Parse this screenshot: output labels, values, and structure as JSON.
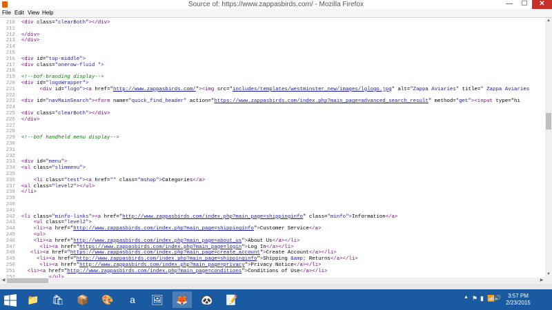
{
  "window": {
    "title": "Source of: https://www.zappasbirds.com/ - Mozilla Firefox",
    "minimize_glyph": "—",
    "maximize_glyph": "☐",
    "close_glyph": "✕"
  },
  "menubar": {
    "items": [
      "File",
      "Edit",
      "View",
      "Help"
    ]
  },
  "source_lines": [
    {
      "n": "210",
      "segs": [
        {
          "k": "t",
          "x": "<div "
        },
        {
          "k": "a",
          "x": "class="
        },
        {
          "k": "v",
          "x": "\"clearBoth\""
        },
        {
          "k": "t",
          "x": "></div>"
        }
      ]
    },
    {
      "n": "211",
      "segs": []
    },
    {
      "n": "212",
      "segs": [
        {
          "k": "t",
          "x": "</div>"
        }
      ]
    },
    {
      "n": "213",
      "segs": [
        {
          "k": "t",
          "x": "</div>"
        }
      ]
    },
    {
      "n": "214",
      "segs": []
    },
    {
      "n": "215",
      "segs": []
    },
    {
      "n": "216",
      "segs": [
        {
          "k": "t",
          "x": "<div "
        },
        {
          "k": "a",
          "x": "id="
        },
        {
          "k": "v",
          "x": "\"top-middle\""
        },
        {
          "k": "t",
          "x": ">"
        }
      ]
    },
    {
      "n": "217",
      "segs": [
        {
          "k": "t",
          "x": "<div "
        },
        {
          "k": "a",
          "x": "class="
        },
        {
          "k": "v",
          "x": "\"onerow-fluid \""
        },
        {
          "k": "t",
          "x": ">"
        }
      ]
    },
    {
      "n": "218",
      "segs": []
    },
    {
      "n": "219",
      "segs": [
        {
          "k": "c",
          "x": "<!--bof-branding display-->"
        }
      ]
    },
    {
      "n": "220",
      "segs": [
        {
          "k": "t",
          "x": "<div "
        },
        {
          "k": "a",
          "x": "id="
        },
        {
          "k": "v",
          "x": "\"logoWrapper\""
        },
        {
          "k": "t",
          "x": ">"
        }
      ]
    },
    {
      "n": "221",
      "segs": [
        {
          "k": "t",
          "x": "      <div "
        },
        {
          "k": "a",
          "x": "id="
        },
        {
          "k": "v",
          "x": "\"logo\""
        },
        {
          "k": "t",
          "x": "><a "
        },
        {
          "k": "a",
          "x": "href=\""
        },
        {
          "k": "l",
          "x": "http://www.zappasbirds.com/"
        },
        {
          "k": "a",
          "x": "\""
        },
        {
          "k": "t",
          "x": "><img "
        },
        {
          "k": "a",
          "x": "src=\""
        },
        {
          "k": "l",
          "x": "includes/templates/westminster_new/images/lglogo.jpg"
        },
        {
          "k": "a",
          "x": "\" alt="
        },
        {
          "k": "v",
          "x": "\"Zappa Aviaries\""
        },
        {
          "k": "a",
          "x": " title="
        },
        {
          "k": "v",
          "x": "\" Zappa Aviaries"
        }
      ]
    },
    {
      "n": "222",
      "segs": []
    },
    {
      "n": "223",
      "segs": [
        {
          "k": "t",
          "x": "<div "
        },
        {
          "k": "a",
          "x": "id="
        },
        {
          "k": "v",
          "x": "\"navMainSearch\""
        },
        {
          "k": "t",
          "x": "><form "
        },
        {
          "k": "a",
          "x": "name="
        },
        {
          "k": "v",
          "x": "\"quick_find_header\""
        },
        {
          "k": "a",
          "x": " action=\""
        },
        {
          "k": "l",
          "x": "https://www.zappasbirds.com/index.php?main_page=advanced_search_result"
        },
        {
          "k": "a",
          "x": "\" method="
        },
        {
          "k": "v",
          "x": "\"get\""
        },
        {
          "k": "t",
          "x": "><input "
        },
        {
          "k": "a",
          "x": "type=\"hi"
        }
      ]
    },
    {
      "n": "224",
      "segs": []
    },
    {
      "n": "225",
      "segs": [
        {
          "k": "t",
          "x": "<div "
        },
        {
          "k": "a",
          "x": "class="
        },
        {
          "k": "v",
          "x": "\"clearBoth\""
        },
        {
          "k": "t",
          "x": "></div>"
        }
      ]
    },
    {
      "n": "226",
      "segs": [
        {
          "k": "t",
          "x": "</div>"
        }
      ]
    },
    {
      "n": "227",
      "segs": []
    },
    {
      "n": "228",
      "segs": []
    },
    {
      "n": "229",
      "segs": [
        {
          "k": "c",
          "x": "<!--bof handheld menu display-->"
        }
      ]
    },
    {
      "n": "230",
      "segs": []
    },
    {
      "n": "231",
      "segs": []
    },
    {
      "n": "232",
      "segs": []
    },
    {
      "n": "233",
      "segs": [
        {
          "k": "t",
          "x": "<div "
        },
        {
          "k": "a",
          "x": "id="
        },
        {
          "k": "v",
          "x": "\"menu\""
        },
        {
          "k": "t",
          "x": ">"
        }
      ]
    },
    {
      "n": "234",
      "segs": [
        {
          "k": "t",
          "x": "<ul "
        },
        {
          "k": "a",
          "x": "class="
        },
        {
          "k": "v",
          "x": "\"slimmenu\""
        },
        {
          "k": "t",
          "x": ">"
        }
      ]
    },
    {
      "n": "235",
      "segs": []
    },
    {
      "n": "236",
      "segs": [
        {
          "k": "t",
          "x": "    <li "
        },
        {
          "k": "a",
          "x": "class="
        },
        {
          "k": "v",
          "x": "\"test\""
        },
        {
          "k": "t",
          "x": "><a "
        },
        {
          "k": "a",
          "x": "href="
        },
        {
          "k": "v",
          "x": "\"\""
        },
        {
          "k": "a",
          "x": " class="
        },
        {
          "k": "v",
          "x": "\"mshop\""
        },
        {
          "k": "t",
          "x": ">"
        },
        {
          "k": "a",
          "x": "Categories"
        },
        {
          "k": "t",
          "x": "</a>"
        }
      ]
    },
    {
      "n": "237",
      "segs": [
        {
          "k": "t",
          "x": "<ul "
        },
        {
          "k": "a",
          "x": "class="
        },
        {
          "k": "v",
          "x": "\"level2\""
        },
        {
          "k": "t",
          "x": "></ul>"
        }
      ]
    },
    {
      "n": "238",
      "segs": [
        {
          "k": "t",
          "x": "</li>"
        }
      ]
    },
    {
      "n": "239",
      "segs": []
    },
    {
      "n": "240",
      "segs": []
    },
    {
      "n": "241",
      "segs": []
    },
    {
      "n": "242",
      "segs": [
        {
          "k": "t",
          "x": "<li "
        },
        {
          "k": "a",
          "x": "class="
        },
        {
          "k": "v",
          "x": "\"minfo-links\""
        },
        {
          "k": "t",
          "x": "><a "
        },
        {
          "k": "a",
          "x": "href=\""
        },
        {
          "k": "l",
          "x": "http://www.zappasbirds.com/index.php?main_page=shippinginfo"
        },
        {
          "k": "a",
          "x": "\" class="
        },
        {
          "k": "v",
          "x": "\"minfo\""
        },
        {
          "k": "t",
          "x": ">"
        },
        {
          "k": "a",
          "x": "Information"
        },
        {
          "k": "t",
          "x": "</a>"
        }
      ]
    },
    {
      "n": "243",
      "segs": [
        {
          "k": "t",
          "x": "    <ul "
        },
        {
          "k": "a",
          "x": "class="
        },
        {
          "k": "v",
          "x": "\"level2\""
        },
        {
          "k": "t",
          "x": ">"
        }
      ]
    },
    {
      "n": "244",
      "segs": [
        {
          "k": "t",
          "x": "    <li><a "
        },
        {
          "k": "a",
          "x": "href=\""
        },
        {
          "k": "l",
          "x": "http://www.zappasbirds.com/index.php?main_page=shippinginfo"
        },
        {
          "k": "a",
          "x": "\""
        },
        {
          "k": "t",
          "x": ">"
        },
        {
          "k": "a",
          "x": "Customer Service"
        },
        {
          "k": "t",
          "x": "</a>"
        }
      ]
    },
    {
      "n": "245",
      "segs": [
        {
          "k": "t",
          "x": "    <ul>"
        }
      ]
    },
    {
      "n": "246",
      "segs": [
        {
          "k": "t",
          "x": "    <li><a "
        },
        {
          "k": "a",
          "x": "href=\""
        },
        {
          "k": "l",
          "x": "http://www.zappasbirds.com/index.php?main_page=about_us"
        },
        {
          "k": "a",
          "x": "\""
        },
        {
          "k": "t",
          "x": ">"
        },
        {
          "k": "a",
          "x": "About Us"
        },
        {
          "k": "t",
          "x": "</a></li>"
        }
      ]
    },
    {
      "n": "247",
      "segs": [
        {
          "k": "t",
          "x": "      <li><a "
        },
        {
          "k": "a",
          "x": "href=\""
        },
        {
          "k": "l",
          "x": "https://www.zappasbirds.com/index.php?main_page=login"
        },
        {
          "k": "a",
          "x": "\""
        },
        {
          "k": "t",
          "x": ">"
        },
        {
          "k": "a",
          "x": "Log In"
        },
        {
          "k": "t",
          "x": "</a></li>"
        }
      ]
    },
    {
      "n": "248",
      "segs": [
        {
          "k": "t",
          "x": "   <li><a "
        },
        {
          "k": "a",
          "x": "href=\""
        },
        {
          "k": "l",
          "x": "https://www.zappasbirds.com/index.php?main_page=create_account"
        },
        {
          "k": "a",
          "x": "\""
        },
        {
          "k": "t",
          "x": ">"
        },
        {
          "k": "a",
          "x": "Create Account"
        },
        {
          "k": "t",
          "x": "</a></li>"
        }
      ]
    },
    {
      "n": "249",
      "segs": [
        {
          "k": "t",
          "x": "     <li><a "
        },
        {
          "k": "a",
          "x": "href=\""
        },
        {
          "k": "l",
          "x": "http://www.zappasbirds.com/index.php?main_page=shippinginfo"
        },
        {
          "k": "a",
          "x": "\""
        },
        {
          "k": "t",
          "x": ">"
        },
        {
          "k": "a",
          "x": "Shipping "
        },
        {
          "k": "v",
          "x": "&amp;"
        },
        {
          "k": "a",
          "x": " Returns"
        },
        {
          "k": "t",
          "x": "</a></li>"
        }
      ]
    },
    {
      "n": "250",
      "segs": [
        {
          "k": "t",
          "x": "      <li><a "
        },
        {
          "k": "a",
          "x": "href=\""
        },
        {
          "k": "l",
          "x": "http://www.zappasbirds.com/index.php?main_page=privacy"
        },
        {
          "k": "a",
          "x": "\""
        },
        {
          "k": "t",
          "x": ">"
        },
        {
          "k": "a",
          "x": "Privacy Notice"
        },
        {
          "k": "t",
          "x": "</a></li>"
        }
      ]
    },
    {
      "n": "251",
      "segs": [
        {
          "k": "t",
          "x": "  <li><a "
        },
        {
          "k": "a",
          "x": "href=\""
        },
        {
          "k": "l",
          "x": "http://www.zappasbirds.com/index.php?main_page=conditions"
        },
        {
          "k": "a",
          "x": "\""
        },
        {
          "k": "t",
          "x": ">"
        },
        {
          "k": "a",
          "x": "Conditions of Use"
        },
        {
          "k": "t",
          "x": "</a></li>"
        }
      ]
    },
    {
      "n": "252",
      "segs": [
        {
          "k": "t",
          "x": "         </ul>"
        }
      ]
    }
  ],
  "taskbar": {
    "icons": [
      {
        "name": "file-explorer-icon",
        "glyph": "📁",
        "active": false
      },
      {
        "name": "store-icon",
        "glyph": "🛍",
        "active": false
      },
      {
        "name": "box-app-icon",
        "glyph": "📦",
        "active": false
      },
      {
        "name": "paint-icon",
        "glyph": "🎨",
        "active": false
      },
      {
        "name": "amazon-icon",
        "glyph": "a",
        "active": false
      },
      {
        "name": "photo-editor-icon",
        "glyph": "🖼",
        "active": false
      },
      {
        "name": "firefox-icon",
        "glyph": "🦊",
        "active": true
      },
      {
        "name": "panda-app-icon",
        "glyph": "🐼",
        "active": false
      },
      {
        "name": "notes-icon",
        "glyph": "📝",
        "active": false
      }
    ],
    "tray": {
      "chevron": "▲",
      "flag": "⚑",
      "battery": "▮",
      "network": "📶",
      "volume": "🔊",
      "time": "3:57 PM",
      "date": "2/23/2015"
    }
  },
  "colors": {
    "taskbar": "#1a5aa0",
    "tag": "#7a007a",
    "attr_value": "#1a1aa6",
    "comment": "#007f00",
    "close_button": "#c7302a"
  }
}
